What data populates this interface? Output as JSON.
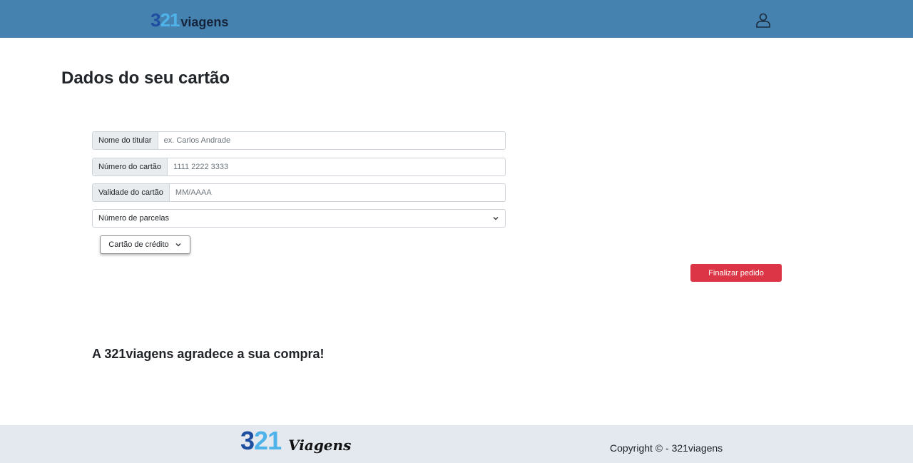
{
  "header": {
    "logo": {
      "digit3": "3",
      "digit2": "2",
      "digit1": "1",
      "word": "viagens"
    },
    "user_icon": "user-icon"
  },
  "main": {
    "title": "Dados do seu cartão",
    "fields": [
      {
        "label": "Nome do titular",
        "placeholder": "ex. Carlos Andrade",
        "value": ""
      },
      {
        "label": "Número do cartão",
        "placeholder": "1111 2222 3333",
        "value": ""
      },
      {
        "label": "Validade do cartão",
        "placeholder": "MM/AAAA",
        "value": ""
      }
    ],
    "installments_select": {
      "selected": "Número de parcelas"
    },
    "payment_dropdown": {
      "label": "Cartão de crédito"
    },
    "finalize_button": "Finalizar pedido",
    "thanks_message": "A 321viagens agradece a sua compra!"
  },
  "footer": {
    "logo": {
      "digit3": "3",
      "digit2": "2",
      "digit1": "1",
      "word": "Viagens"
    },
    "copyright": "Copyright © - 321viagens"
  },
  "colors": {
    "navbar": "#4682b0",
    "footer": "#e3e9ef",
    "accent_dark_blue": "#1e4ea0",
    "accent_light_blue": "#4fb3ea",
    "danger_button": "#dc3545"
  }
}
